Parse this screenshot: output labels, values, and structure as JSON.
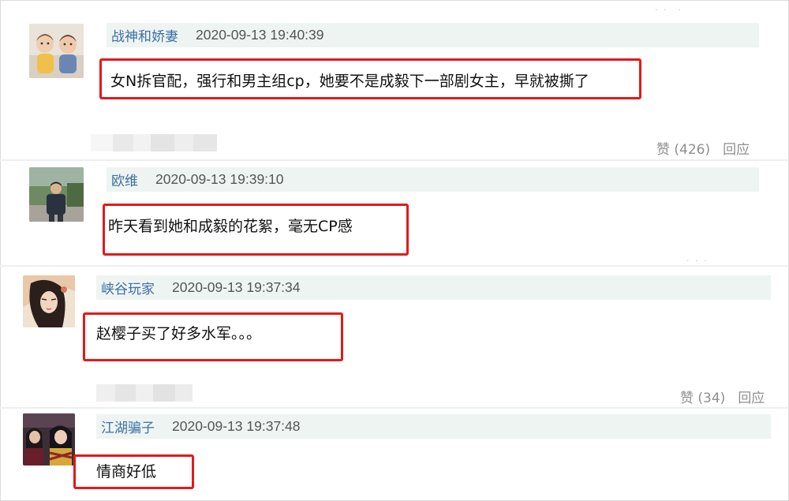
{
  "comments": [
    {
      "user": "战神和娇妻",
      "time": "2020-09-13 19:40:39",
      "text": "女N拆官配，强行和男主组cp，她要不是成毅下一部剧女主，早就被撕了",
      "likes": "赞 (426)",
      "reply": "回应"
    },
    {
      "user": "欧维",
      "time": "2020-09-13 19:39:10",
      "text": "昨天看到她和成毅的花絮，毫无CP感"
    },
    {
      "user": "峡谷玩家",
      "time": "2020-09-13 19:37:34",
      "text": "赵樱子买了好多水军。。。",
      "likes": "赞 (34)",
      "reply": "回应"
    },
    {
      "user": "江湖骗子",
      "time": "2020-09-13 19:37:48",
      "text": "情商好低"
    }
  ],
  "colors": {
    "highlight": "#e3191b",
    "username": "#3b6fa5",
    "meta_bg": "#eef4f1",
    "action": "#8f8f8f"
  }
}
